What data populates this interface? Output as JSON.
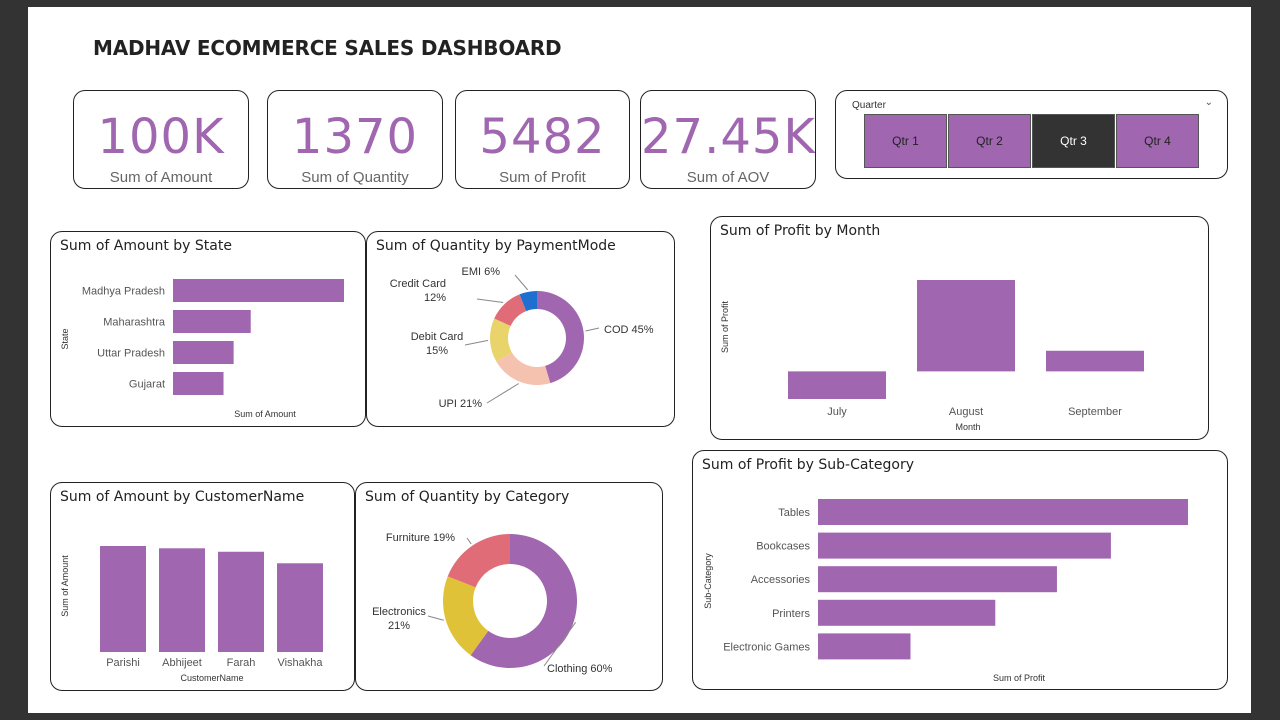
{
  "dashboard_title": "MADHAV ECOMMERCE SALES DASHBOARD",
  "kpis": [
    {
      "value": "100K",
      "label": "Sum of Amount"
    },
    {
      "value": "1370",
      "label": "Sum of Quantity"
    },
    {
      "value": "5482",
      "label": "Sum of Profit"
    },
    {
      "value": "27.45K",
      "label": "Sum of AOV"
    }
  ],
  "slicer": {
    "title": "Quarter",
    "options": [
      "Qtr 1",
      "Qtr 2",
      "Qtr 3",
      "Qtr 4"
    ],
    "selected": "Qtr 3"
  },
  "colors": {
    "accent": "#a066b0",
    "selected": "#333333"
  },
  "chart_data": [
    {
      "type": "bar",
      "orientation": "horizontal",
      "title": "Sum of Amount by State",
      "categories": [
        "Madhya Pradesh",
        "Maharashtra",
        "Uttar Pradesh",
        "Gujarat"
      ],
      "values": [
        22000,
        10000,
        7800,
        6500
      ],
      "xlabel": "Sum of Amount",
      "ylabel": "State",
      "color": "#a066b0"
    },
    {
      "type": "pie",
      "donut": true,
      "title": "Sum of Quantity by PaymentMode",
      "slices": [
        {
          "name": "COD",
          "value": 45,
          "label": "COD 45%",
          "color": "#a066b0"
        },
        {
          "name": "UPI",
          "value": 21,
          "label": "UPI 21%",
          "color": "#f5c2b0"
        },
        {
          "name": "Debit Card",
          "value": 15,
          "label": "Debit Card 15%",
          "color": "#e8d46a"
        },
        {
          "name": "Credit Card",
          "value": 12,
          "label": "Credit Card 12%",
          "color": "#e06c78"
        },
        {
          "name": "EMI",
          "value": 6,
          "label": "EMI 6%",
          "color": "#1f6fd1"
        }
      ]
    },
    {
      "type": "bar",
      "title": "Sum of Profit by Month",
      "categories": [
        "July",
        "August",
        "September"
      ],
      "values": [
        -1300,
        4300,
        970
      ],
      "xlabel": "Month",
      "ylabel": "Sum of Profit",
      "color": "#a066b0"
    },
    {
      "type": "bar",
      "title": "Sum of Amount by CustomerName",
      "categories": [
        "Parishi",
        "Abhijeet",
        "Farah",
        "Vishakha"
      ],
      "values": [
        9200,
        9000,
        8700,
        7700
      ],
      "xlabel": "CustomerName",
      "ylabel": "Sum of Amount",
      "color": "#a066b0"
    },
    {
      "type": "pie",
      "donut": true,
      "title": "Sum of Quantity by Category",
      "slices": [
        {
          "name": "Clothing",
          "value": 60,
          "label": "Clothing 60%",
          "color": "#a066b0"
        },
        {
          "name": "Electronics",
          "value": 21,
          "label": "Electronics 21%",
          "color": "#e0c238"
        },
        {
          "name": "Furniture",
          "value": 19,
          "label": "Furniture 19%",
          "color": "#e06c78"
        }
      ]
    },
    {
      "type": "bar",
      "orientation": "horizontal",
      "title": "Sum of Profit by Sub-Category",
      "categories": [
        "Tables",
        "Bookcases",
        "Accessories",
        "Printers",
        "Electronic Games"
      ],
      "values": [
        4800,
        3800,
        3100,
        2300,
        1200
      ],
      "xlabel": "Sum of Profit",
      "ylabel": "Sub-Category",
      "color": "#a066b0"
    }
  ]
}
